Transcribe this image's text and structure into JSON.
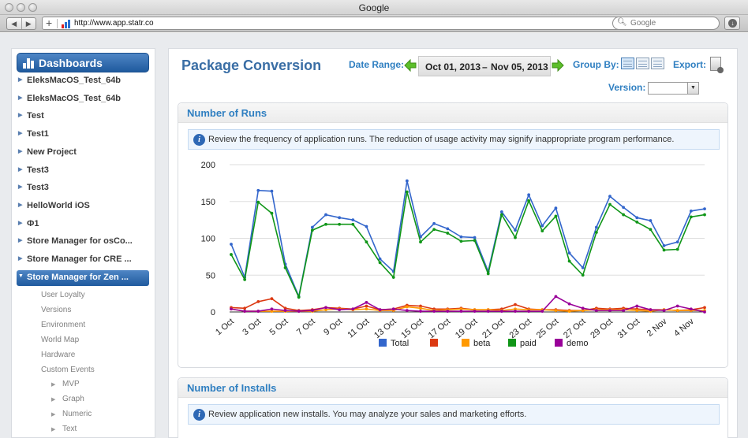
{
  "browser": {
    "window_title": "Google",
    "url": "http://www.app.statr.co",
    "search_placeholder": "Google"
  },
  "sidebar": {
    "header": "Dashboards",
    "items": [
      {
        "label": "EleksMacOS_Test_64b"
      },
      {
        "label": "EleksMacOS_Test_64b"
      },
      {
        "label": "Test"
      },
      {
        "label": "Test1"
      },
      {
        "label": "New Project"
      },
      {
        "label": "Test3"
      },
      {
        "label": "Test3"
      },
      {
        "label": "HelloWorld iOS"
      },
      {
        "label": "Ф1"
      },
      {
        "label": "Store Manager for osCo..."
      },
      {
        "label": "Store Manager for CRE ..."
      },
      {
        "label": "Store Manager for Zen ..."
      }
    ],
    "subitems": [
      "User Loyalty",
      "Versions",
      "Environment",
      "World Map",
      "Hardware",
      "Custom Events"
    ],
    "custom_events": [
      "MVP",
      "Graph",
      "Numeric",
      "Text"
    ]
  },
  "header": {
    "title": "Package Conversion",
    "date_range_label": "Date Range:",
    "date_from": "Oct 01, 2013",
    "date_dash": "–",
    "date_to": "Nov 05, 2013",
    "group_by_label": "Group By:",
    "export_label": "Export:",
    "version_label": "Version:"
  },
  "runs_panel": {
    "title": "Number of Runs",
    "info": "Review the frequency of application runs. The reduction of usage activity may signify inappropriate program performance."
  },
  "installs_panel": {
    "title": "Number of Installs",
    "info": "Review application new installs. You may analyze your sales and marketing efforts."
  },
  "chart_data": {
    "type": "line",
    "x": [
      "1 Oct",
      "2 Oct",
      "3 Oct",
      "4 Oct",
      "5 Oct",
      "6 Oct",
      "7 Oct",
      "8 Oct",
      "9 Oct",
      "10 Oct",
      "11 Oct",
      "12 Oct",
      "13 Oct",
      "14 Oct",
      "15 Oct",
      "16 Oct",
      "17 Oct",
      "18 Oct",
      "19 Oct",
      "20 Oct",
      "21 Oct",
      "22 Oct",
      "23 Oct",
      "24 Oct",
      "25 Oct",
      "26 Oct",
      "27 Oct",
      "28 Oct",
      "29 Oct",
      "30 Oct",
      "31 Oct",
      "1 Nov",
      "2 Nov",
      "3 Nov",
      "4 Nov",
      "5 Nov"
    ],
    "xtick_labels": [
      "1 Oct",
      "3 Oct",
      "5 Oct",
      "7 Oct",
      "9 Oct",
      "11 Oct",
      "13 Oct",
      "15 Oct",
      "17 Oct",
      "19 Oct",
      "21 Oct",
      "23 Oct",
      "25 Oct",
      "27 Oct",
      "29 Oct",
      "31 Oct",
      "2 Nov",
      "4 Nov"
    ],
    "ylim": [
      0,
      200
    ],
    "yticks": [
      0,
      50,
      100,
      150,
      200
    ],
    "grid": true,
    "legend_placement": "bottom",
    "series": [
      {
        "name": "Total",
        "color": "#3366cc",
        "values": [
          92,
          47,
          165,
          164,
          65,
          21,
          115,
          132,
          128,
          125,
          116,
          72,
          55,
          178,
          102,
          120,
          113,
          102,
          101,
          55,
          136,
          111,
          159,
          117,
          141,
          80,
          60,
          115,
          157,
          142,
          128,
          124,
          90,
          95,
          137,
          140
        ]
      },
      {
        "name": "",
        "color": "#dc3912",
        "values": [
          6,
          5,
          14,
          18,
          5,
          2,
          3,
          6,
          5,
          4,
          8,
          3,
          4,
          9,
          8,
          4,
          4,
          5,
          3,
          3,
          4,
          10,
          4,
          3,
          3,
          2,
          2,
          5,
          4,
          5,
          4,
          3,
          3,
          2,
          3,
          6
        ]
      },
      {
        "name": "beta",
        "color": "#ff9900",
        "values": [
          4,
          1,
          1,
          1,
          1,
          1,
          1,
          3,
          4,
          3,
          4,
          2,
          2,
          7,
          5,
          2,
          3,
          4,
          3,
          3,
          2,
          4,
          3,
          3,
          2,
          1,
          2,
          3,
          3,
          3,
          2,
          1,
          3,
          2,
          2,
          2
        ]
      },
      {
        "name": "paid",
        "color": "#109618",
        "values": [
          78,
          44,
          149,
          134,
          60,
          20,
          111,
          119,
          119,
          119,
          95,
          67,
          47,
          163,
          95,
          112,
          107,
          96,
          97,
          52,
          132,
          101,
          151,
          110,
          130,
          69,
          50,
          108,
          146,
          132,
          122,
          112,
          84,
          85,
          129,
          132
        ]
      },
      {
        "name": "demo",
        "color": "#990099",
        "values": [
          4,
          1,
          1,
          4,
          2,
          1,
          2,
          6,
          3,
          4,
          13,
          3,
          4,
          2,
          1,
          1,
          1,
          1,
          1,
          1,
          1,
          1,
          1,
          1,
          21,
          11,
          5,
          2,
          2,
          2,
          8,
          3,
          2,
          8,
          4,
          0
        ]
      }
    ]
  }
}
